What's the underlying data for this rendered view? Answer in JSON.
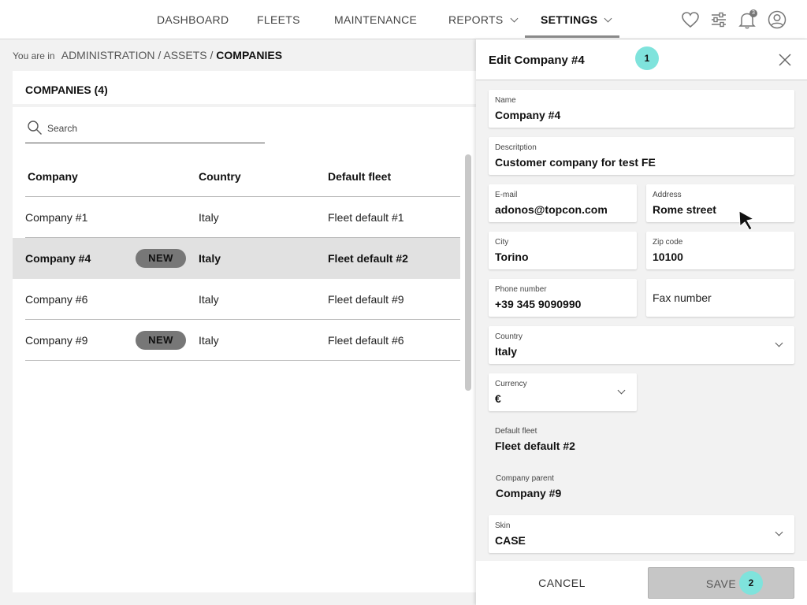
{
  "nav": {
    "items": [
      {
        "label": "DASHBOARD"
      },
      {
        "label": "FLEETS"
      },
      {
        "label": "MAINTENANCE"
      },
      {
        "label": "REPORTS"
      },
      {
        "label": "SETTINGS"
      }
    ],
    "active": "SETTINGS",
    "icons": [
      "heart-icon",
      "sliders-icon",
      "bell-icon",
      "user-icon"
    ],
    "notification_count": "3"
  },
  "breadcrumb": {
    "prefix": "You are in",
    "path": "ADMINISTRATION / ASSETS /",
    "current": "COMPANIES"
  },
  "list": {
    "title": "COMPANIES (4)",
    "search_placeholder": "Search",
    "columns": [
      "Company",
      "Country",
      "Default fleet"
    ],
    "rows": [
      {
        "company": "Company #1",
        "badge": "",
        "country": "Italy",
        "fleet": "Fleet default #1"
      },
      {
        "company": "Company #4",
        "badge": "NEW",
        "country": "Italy",
        "fleet": "Fleet default #2",
        "selected": true
      },
      {
        "company": "Company #6",
        "badge": "",
        "country": "Italy",
        "fleet": "Fleet default #9"
      },
      {
        "company": "Company #9",
        "badge": "NEW",
        "country": "Italy",
        "fleet": "Fleet default #6"
      }
    ]
  },
  "drawer": {
    "title": "Edit Company #4",
    "step1": "1",
    "step2": "2",
    "fields": {
      "name": {
        "label": "Name",
        "value": "Company #4"
      },
      "description": {
        "label": "Descritption",
        "value": "Customer company for test FE"
      },
      "email": {
        "label": "E-mail",
        "value": "adonos@topcon.com"
      },
      "address": {
        "label": "Address",
        "value": "Rome street"
      },
      "city": {
        "label": "City",
        "value": "Torino"
      },
      "zip": {
        "label": "Zip code",
        "value": "10100"
      },
      "phone": {
        "label": "Phone number",
        "value": "+39 345 9090990"
      },
      "fax": {
        "placeholder": "Fax number"
      },
      "country": {
        "label": "Country",
        "value": "Italy"
      },
      "currency": {
        "label": "Currency",
        "value": "€"
      },
      "default_fleet": {
        "label": "Default fleet",
        "value": "Fleet default #2"
      },
      "company_parent": {
        "label": "Company parent",
        "value": "Company #9"
      },
      "skin": {
        "label": "Skin",
        "value": "CASE"
      }
    },
    "cancel_label": "CANCEL",
    "save_label": "SAVE"
  },
  "colors": {
    "accent": "#7fe3dc",
    "selected_row": "#e1e1e1",
    "badge": "#777777"
  }
}
